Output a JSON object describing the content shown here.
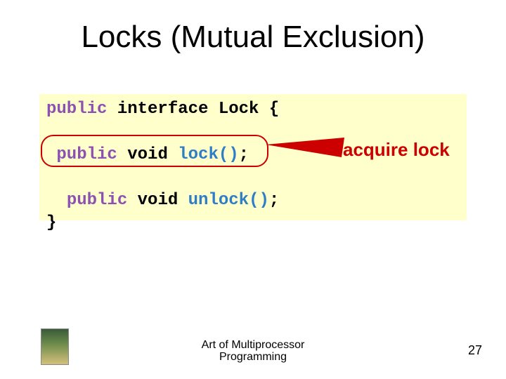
{
  "title": "Locks (Mutual Exclusion)",
  "code": {
    "l1_public": "public",
    "l1_rest": " interface Lock {",
    "l2_space": " ",
    "l2_public": "public",
    "l2_void": " void ",
    "l2_name": "lock()",
    "l2_semi": ";",
    "l3_space": "  ",
    "l3_public": "public",
    "l3_void": " void ",
    "l3_name": "unlock()",
    "l3_semi": ";",
    "l4": "}"
  },
  "callout": {
    "label": "acquire lock",
    "color": "#cc0000"
  },
  "footer": {
    "line1": "Art of Multiprocessor",
    "line2": "Programming"
  },
  "page_number": "27"
}
